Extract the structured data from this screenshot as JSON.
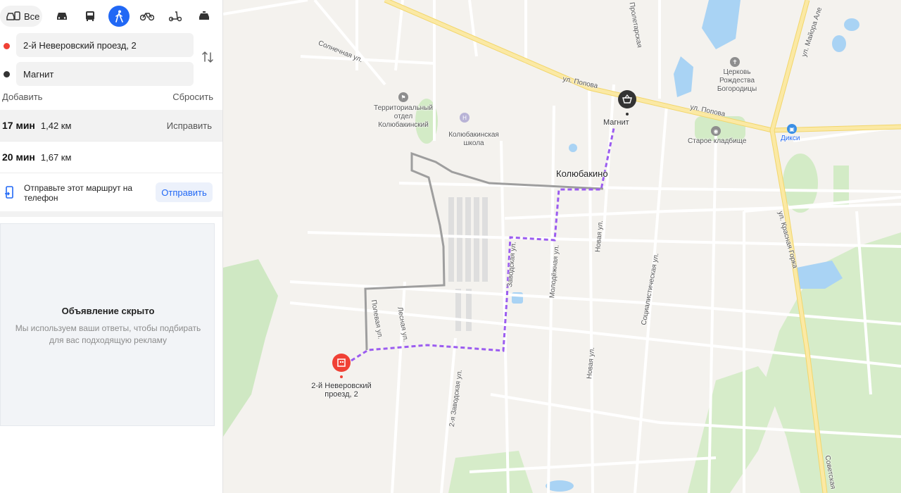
{
  "modes": {
    "all_label": "Все",
    "active": "pedestrian"
  },
  "route": {
    "from": "2-й Неверовский проезд, 2",
    "to": "Магнит",
    "add_label": "Добавить",
    "reset_label": "Сбросить"
  },
  "options": [
    {
      "time": "17 мин",
      "distance": "1,42 км",
      "action": "Исправить",
      "selected": true
    },
    {
      "time": "20 мин",
      "distance": "1,67 км",
      "action": "",
      "selected": false
    }
  ],
  "send": {
    "text": "Отправьте этот маршрут на телефон",
    "button": "Отправить"
  },
  "ad": {
    "title": "Объявление скрыто",
    "subtitle": "Мы используем ваши ответы, чтобы подбирать для вас подходящую рекламу"
  },
  "map": {
    "labels": {
      "village": "Колюбакино",
      "magnit": "Магнит",
      "start": "2-й Неверовский проезд, 2",
      "school": "Колюбакинская школа",
      "territorial": "Территориальный отдел Колюбакинский",
      "church": "Церковь Рождества Богородицы",
      "cemetery": "Старое кладбище",
      "dixy": "Дикси"
    },
    "streets": {
      "popova1": "ул. Попова",
      "popova2": "ул. Попова",
      "solnechnaya": "Солнечная ул.",
      "polevaya": "Полевая ул.",
      "lesnaya": "Лесная ул.",
      "zavodskaya": "Заводская ул.",
      "zavodskaya2": "2-я Заводская ул.",
      "molodezhnaya": "Молодёжная ул.",
      "novaya1": "Новая ул.",
      "novaya2": "Новая ул.",
      "socialist": "Социалистическая ул.",
      "krasnaya": "ул. Красная Горка",
      "mayora": "ул. Майора Але",
      "sovetskaya": "Советская",
      "proletarskaya": "Пролетарская"
    },
    "colors": {
      "route_primary": "#9b5cf0",
      "route_alt": "#9e9e9e",
      "road_main": "#f7e08a",
      "water": "#a9d3f4",
      "forest": "#cfe8c3"
    }
  }
}
